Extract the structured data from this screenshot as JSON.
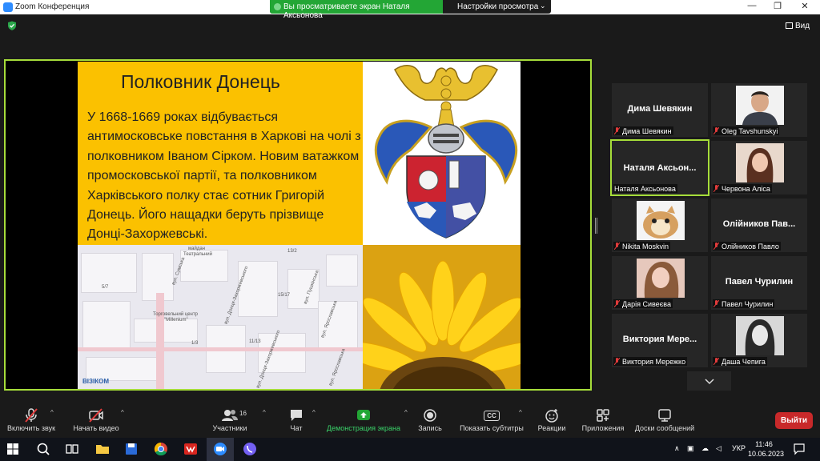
{
  "window": {
    "app_title": "Zoom Конференция",
    "minimize_glyph": "—",
    "restore_glyph": "❐",
    "close_glyph": "✕"
  },
  "share_banner": {
    "status_text": "Вы просматриваете экран Наталя Аксьонова",
    "view_options_label": "Настройки просмотра",
    "chevron": "⌄"
  },
  "top_bar": {
    "view_label": "Вид"
  },
  "slide": {
    "title": "Полковник Донець",
    "body": "У 1668-1669 роках відбувається антимосковське повстання в Харкові на чолі з полковником Іваном Сірком. Новим ватажком промосковської партії, та полковником Харківського полку стає сотник Григорій Донець. Його нащадки беруть прізвище Донці-Захоржевські.",
    "map_labels": [
      "майдан",
      "Театральний",
      "вул. Сумська",
      "вул. Донця-Захоржевського",
      "Торговельний центр",
      "\"Millenium\"",
      "вул. Пушкінська",
      "вул. Ярославська",
      "вул. Донця-Захоржевського",
      "вул. Ярославська",
      "15/17",
      "1/3",
      "11/13",
      "13/2",
      "5/7"
    ],
    "map_logo": "ВІЗІКОМ"
  },
  "participants": [
    {
      "name": "Дима Шевякин",
      "label": "Дима Шевякин",
      "has_photo": false
    },
    {
      "name": "",
      "label": "Oleg Tavshunskyi",
      "has_photo": true
    },
    {
      "name": "Наталя  Аксьон...",
      "label": "Наталя Аксьонова",
      "has_photo": false,
      "active": true
    },
    {
      "name": "",
      "label": "Червона Аліса",
      "has_photo": true
    },
    {
      "name": "",
      "label": "Nikita Moskvin",
      "has_photo": true
    },
    {
      "name": "Олійников  Пав...",
      "label": "Олійников Павло",
      "has_photo": false
    },
    {
      "name": "",
      "label": "Дарія Сивеєва",
      "has_photo": true
    },
    {
      "name": "Павел Чурилин",
      "label": "Павел Чурилин",
      "has_photo": false
    },
    {
      "name": "Виктория  Мере...",
      "label": "Виктория Мережко",
      "has_photo": false
    },
    {
      "name": "",
      "label": "Даша Чепига",
      "has_photo": true
    }
  ],
  "toolbar": {
    "unmute": "Включить звук",
    "start_video": "Начать видео",
    "participants": "Участники",
    "participants_count": "16",
    "chat": "Чат",
    "share_screen": "Демонстрация экрана",
    "record": "Запись",
    "captions": "Показать субтитры",
    "reactions": "Реакции",
    "apps": "Приложения",
    "whiteboards": "Доски сообщений",
    "leave": "Выйти",
    "cc_glyph": "CC"
  },
  "taskbar": {
    "language": "УКР",
    "time": "11:46",
    "date": "10.06.2023",
    "tray_chevron": "∧"
  },
  "colors": {
    "share_green": "#23a635",
    "active_border": "#a6dd3a",
    "slide_yellow": "#fbc100",
    "leave_red": "#c8292a",
    "muted_red": "#e23b3b"
  }
}
